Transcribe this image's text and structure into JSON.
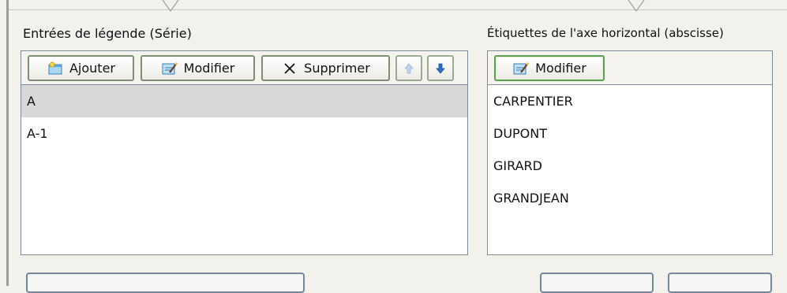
{
  "legend_panel": {
    "title": "Entrées de légende (Série)",
    "toolbar": {
      "add_label": "Ajouter",
      "edit_label": "Modifier",
      "delete_label": "Supprimer"
    },
    "items": [
      {
        "label": "A",
        "selected": true
      },
      {
        "label": "A-1",
        "selected": false
      }
    ]
  },
  "axis_panel": {
    "title": "Étiquettes de l'axe horizontal (abscisse)",
    "toolbar": {
      "edit_label": "Modifier"
    },
    "items": [
      {
        "label": "CARPENTIER"
      },
      {
        "label": "DUPONT"
      },
      {
        "label": "GIRARD"
      },
      {
        "label": "GRANDJEAN"
      }
    ]
  },
  "icons": {
    "add": "add-icon",
    "edit": "edit-icon",
    "delete": "delete-icon",
    "up": "up-arrow-icon",
    "down": "down-arrow-icon"
  }
}
